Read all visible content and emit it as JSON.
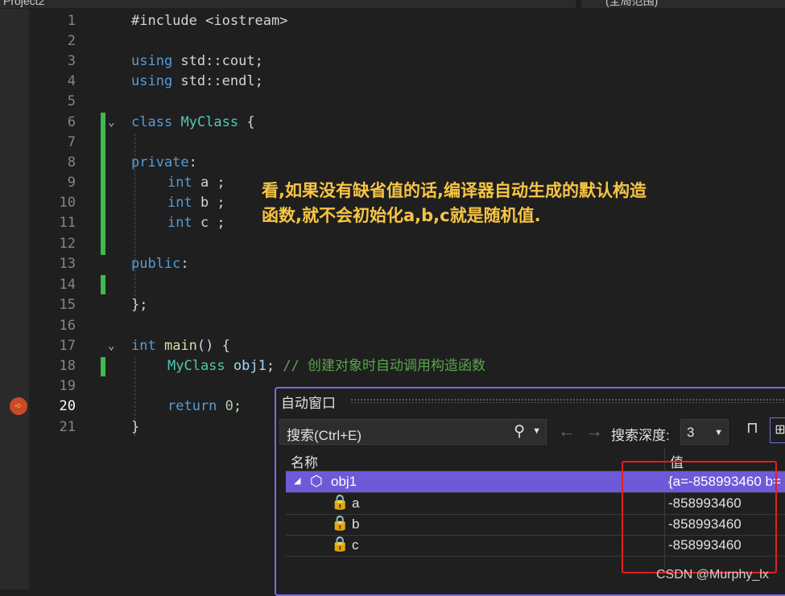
{
  "top": {
    "project": "Project2",
    "scope": "(全局范围)"
  },
  "editor": {
    "current_line": 20,
    "lines": [
      {
        "n": "1"
      },
      {
        "n": "2"
      },
      {
        "n": "3"
      },
      {
        "n": "4"
      },
      {
        "n": "5"
      },
      {
        "n": "6"
      },
      {
        "n": "7"
      },
      {
        "n": "8"
      },
      {
        "n": "9"
      },
      {
        "n": "10"
      },
      {
        "n": "11"
      },
      {
        "n": "12"
      },
      {
        "n": "13"
      },
      {
        "n": "14"
      },
      {
        "n": "15"
      },
      {
        "n": "16"
      },
      {
        "n": "17"
      },
      {
        "n": "18"
      },
      {
        "n": "19"
      },
      {
        "n": "20"
      },
      {
        "n": "21"
      }
    ],
    "code": {
      "l1_directive": "#include ",
      "l1_header": "<iostream>",
      "l3_using": "using",
      "l3_ns": " std::",
      "l3_name": "cout",
      "l3_semi": ";",
      "l4_using": "using",
      "l4_ns": " std::",
      "l4_name": "endl",
      "l4_semi": ";",
      "l6_class": "class",
      "l6_name": "MyClass",
      "l6_brace": " {",
      "l8_private": "private",
      "l8_colon": ":",
      "l9_type": "int",
      "l9_rest": " a ;",
      "l10_type": "int",
      "l10_rest": " b ;",
      "l11_type": "int",
      "l11_rest": " c ;",
      "l13_public": "public",
      "l13_colon": ":",
      "l15_close": "};",
      "l17_type": "int",
      "l17_fn": " main",
      "l17_rest": "() {",
      "l18_type": "MyClass",
      "l18_var": " obj1",
      "l18_semi": ";",
      "l18_comment": " // 创建对象时自动调用构造函数",
      "l20_return": "return",
      "l20_num": " 0",
      "l20_semi": ";",
      "l21_close": "}"
    }
  },
  "annotation": {
    "line1": "看,如果没有缺省值的话,编译器自动生成的默认构造",
    "line2": "函数,就不会初始化a,b,c就是随机值."
  },
  "autos": {
    "title": "自动窗口",
    "search_placeholder": "搜索(Ctrl+E)",
    "search_depth_label": "搜索深度:",
    "search_depth_value": "3",
    "columns": {
      "name": "名称",
      "value": "值"
    },
    "rows": [
      {
        "name": "obj1",
        "value": "{a=-858993460 b=",
        "expanded": true
      },
      {
        "name": "a",
        "value": "-858993460"
      },
      {
        "name": "b",
        "value": "-858993460"
      },
      {
        "name": "c",
        "value": "-858993460"
      }
    ]
  },
  "watermark": "CSDN @Murphy_lx",
  "icons": {
    "search": "search-icon",
    "back": "arrow-left-icon",
    "forward": "arrow-right-icon",
    "pin": "pin-icon",
    "breakpoint": "current-statement-arrow-icon"
  },
  "colors": {
    "background": "#1f1f1f",
    "keyword": "#569cd6",
    "type": "#4ec9b0",
    "comment": "#57a64a",
    "annotation": "#f7c544",
    "selection": "#6e5ad8",
    "highlight_box": "#e02020"
  }
}
